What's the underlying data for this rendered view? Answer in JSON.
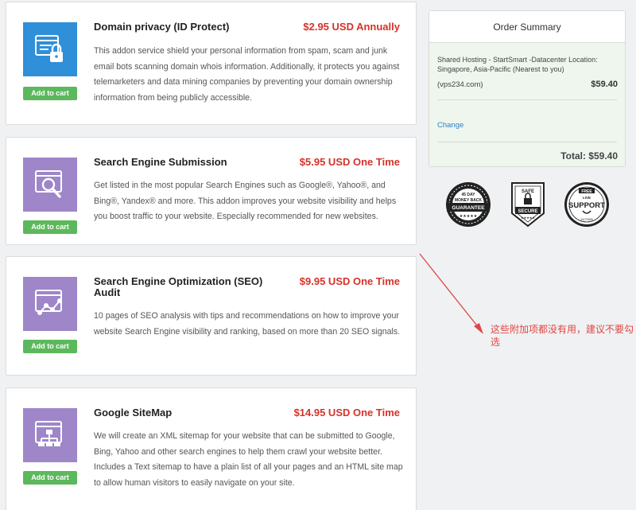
{
  "addons": [
    {
      "title": "Domain privacy (ID Protect)",
      "price": "$2.95 USD Annually",
      "description": "This addon service shield your personal information from spam, scam and junk email bots scanning domain whois information. Additionally, it protects you against telemarketers and data mining companies by preventing your domain ownership information from being publicly accessible.",
      "button": "Add to cart",
      "icon": "privacy-lock-icon",
      "icon_color": "#2f8fd8"
    },
    {
      "title": "Search Engine Submission",
      "price": "$5.95 USD One Time",
      "description": "Get listed in the most popular Search Engines such as Google®, Yahoo®, and Bing®, Yandex® and more. This addon improves your website visibility and helps you boost traffic to your website. Especially recommended for new websites.",
      "button": "Add to cart",
      "icon": "magnifier-icon",
      "icon_color": "#9e86c9"
    },
    {
      "title": "Search Engine Optimization (SEO) Audit",
      "price": "$9.95 USD One Time",
      "description": "10 pages of SEO analysis with tips and recommendations on how to improve your website Search Engine visibility and ranking, based on more than 20 SEO signals.",
      "button": "Add to cart",
      "icon": "seo-graph-icon",
      "icon_color": "#9e86c9"
    },
    {
      "title": "Google SiteMap",
      "price": "$14.95 USD One Time",
      "description": "We will create an XML sitemap for your website that can be submitted to Google, Bing, Yahoo and other search engines to help them crawl your website better. Includes a Text sitemap to have a plain list of all your pages and an HTML site map to allow human visitors to easily navigate on your site.",
      "button": "Add to cart",
      "icon": "sitemap-icon",
      "icon_color": "#9e86c9"
    }
  ],
  "order_summary": {
    "heading": "Order Summary",
    "product": "Shared Hosting - StartSmart -Datacenter Location: Singapore, Asia-Pacific (Nearest to you)",
    "domain": "(vps234.com)",
    "amount": "$59.40",
    "change_label": "Change",
    "total": "Total: $59.40"
  },
  "badges": {
    "guarantee": {
      "line1": "45 DAY",
      "line2": "MONEY BACK",
      "line3": "GUARANTEE"
    },
    "secure": {
      "line1": "SAFE",
      "line2": "SECURE"
    },
    "support": {
      "line1": "FREE",
      "line2": "SUPPORT",
      "line3": "LIVE",
      "line4": "24/7/365"
    }
  },
  "annotation": {
    "text": "这些附加项都没有用，建议不要勾选",
    "color": "#e04646"
  },
  "colors": {
    "price": "#d6322a",
    "cart_button": "#5cb85c",
    "link": "#2f7fc1"
  }
}
